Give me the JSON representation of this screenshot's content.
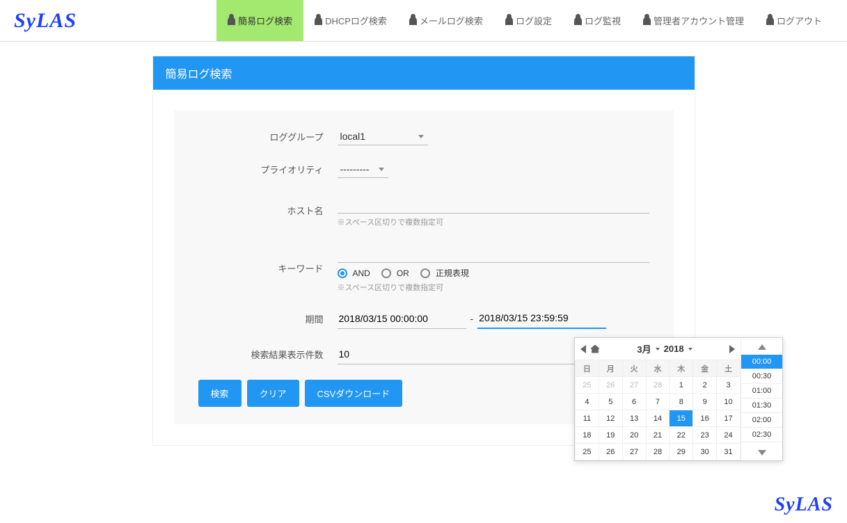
{
  "logo": "SyLAS",
  "nav": [
    {
      "label": "簡易ログ検索",
      "active": true
    },
    {
      "label": "DHCPログ検索",
      "active": false
    },
    {
      "label": "メールログ検索",
      "active": false
    },
    {
      "label": "ログ設定",
      "active": false
    },
    {
      "label": "ログ監視",
      "active": false
    },
    {
      "label": "管理者アカウント管理",
      "active": false
    },
    {
      "label": "ログアウト",
      "active": false
    }
  ],
  "panel": {
    "title": "簡易ログ検索"
  },
  "form": {
    "log_group_label": "ロググループ",
    "log_group_value": "local1",
    "priority_label": "プライオリティ",
    "priority_value": "---------",
    "host_label": "ホスト名",
    "host_value": "",
    "host_hint": "※スペース区切りで複数指定可",
    "keyword_label": "キーワード",
    "keyword_value": "",
    "keyword_hint": "※スペース区切りで複数指定可",
    "radio_and": "AND",
    "radio_or": "OR",
    "radio_regex": "正規表現",
    "period_label": "期間",
    "period_from": "2018/03/15 00:00:00",
    "period_sep": "-",
    "period_to": "2018/03/15 23:59:59",
    "results_label": "検索結果表示件数",
    "results_value": "10"
  },
  "buttons": {
    "search": "検索",
    "clear": "クリア",
    "csv": "CSVダウンロード"
  },
  "datepicker": {
    "month": "3月",
    "year": "2018",
    "dow": [
      "日",
      "月",
      "火",
      "水",
      "木",
      "金",
      "土"
    ],
    "rows": [
      [
        {
          "d": "25",
          "o": true
        },
        {
          "d": "26",
          "o": true
        },
        {
          "d": "27",
          "o": true
        },
        {
          "d": "28",
          "o": true
        },
        {
          "d": "1"
        },
        {
          "d": "2"
        },
        {
          "d": "3"
        }
      ],
      [
        {
          "d": "4"
        },
        {
          "d": "5"
        },
        {
          "d": "6"
        },
        {
          "d": "7"
        },
        {
          "d": "8"
        },
        {
          "d": "9"
        },
        {
          "d": "10"
        }
      ],
      [
        {
          "d": "11"
        },
        {
          "d": "12"
        },
        {
          "d": "13"
        },
        {
          "d": "14"
        },
        {
          "d": "15",
          "sel": true
        },
        {
          "d": "16"
        },
        {
          "d": "17"
        }
      ],
      [
        {
          "d": "18"
        },
        {
          "d": "19"
        },
        {
          "d": "20"
        },
        {
          "d": "21"
        },
        {
          "d": "22"
        },
        {
          "d": "23"
        },
        {
          "d": "24"
        }
      ],
      [
        {
          "d": "25"
        },
        {
          "d": "26"
        },
        {
          "d": "27"
        },
        {
          "d": "28"
        },
        {
          "d": "29"
        },
        {
          "d": "30"
        },
        {
          "d": "31"
        }
      ]
    ],
    "times": [
      {
        "t": "00:00",
        "sel": true
      },
      {
        "t": "00:30"
      },
      {
        "t": "01:00"
      },
      {
        "t": "01:30"
      },
      {
        "t": "02:00"
      },
      {
        "t": "02:30"
      }
    ]
  }
}
